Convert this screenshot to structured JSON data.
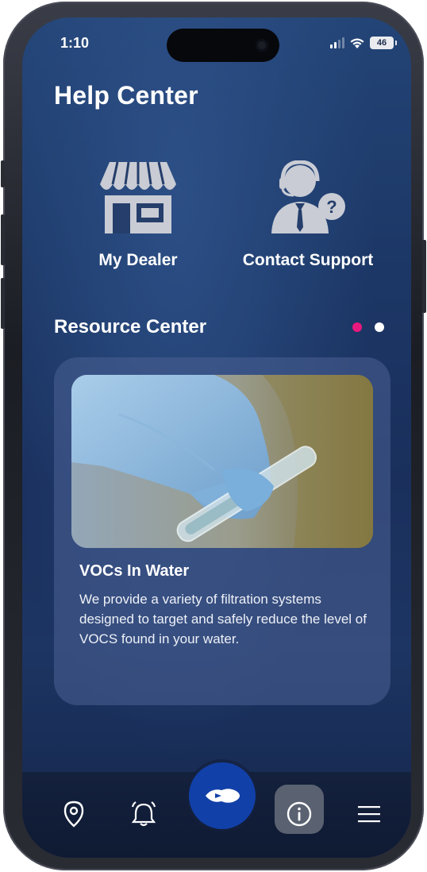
{
  "status_bar": {
    "time": "1:10",
    "battery": "46"
  },
  "header": {
    "title": "Help Center"
  },
  "quick_actions": [
    {
      "label": "My Dealer",
      "icon": "store-icon"
    },
    {
      "label": "Contact Support",
      "icon": "support-agent-icon"
    }
  ],
  "resource_center": {
    "title": "Resource Center",
    "pagination": {
      "count": 2,
      "active_index": 0,
      "active_color": "#e8197d",
      "inactive_color": "#ffffff"
    },
    "card": {
      "title": "VOCs In Water",
      "body": "We provide a variety of filtration systems designed to target and safely reduce the level of VOCS found in your water.",
      "image": "gloved-hand-holding-water-vial"
    }
  },
  "bottom_nav": {
    "items": [
      "location-icon",
      "bell-icon",
      "logo-icon",
      "info-icon",
      "menu-icon"
    ],
    "active": "info-icon",
    "fab_color": "#1140a8"
  },
  "colors": {
    "accent": "#e8197d",
    "background": "#1c3766",
    "card": "#4a6094"
  }
}
